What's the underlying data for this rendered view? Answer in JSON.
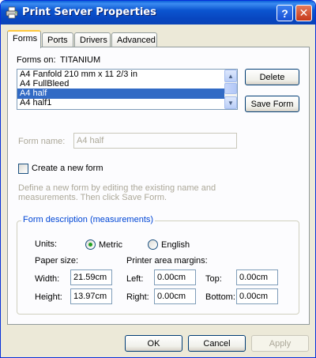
{
  "window": {
    "title": "Print Server Properties",
    "help_button": "?",
    "close_button": "✕"
  },
  "tabs": [
    {
      "label": "Forms"
    },
    {
      "label": "Ports"
    },
    {
      "label": "Drivers"
    },
    {
      "label": "Advanced"
    }
  ],
  "forms": {
    "forms_on_label": "Forms on:",
    "server_name": "TITANIUM",
    "list": [
      {
        "label": "A4 Fanfold 210 mm x 11 2/3 in"
      },
      {
        "label": "A4 FullBleed"
      },
      {
        "label": "A4 half"
      },
      {
        "label": "A4 half1"
      }
    ],
    "selected_index": 2,
    "delete_button": "Delete",
    "save_button": "Save Form",
    "form_name_label": "Form name:",
    "form_name_value": "A4 half",
    "create_new_label": "Create a new form",
    "create_new_checked": false,
    "instructions": "Define a new form by editing the existing name and measurements.  Then click Save Form."
  },
  "description": {
    "group_title": "Form description (measurements)",
    "units_label": "Units:",
    "metric_label": "Metric",
    "english_label": "English",
    "selected_unit": "Metric",
    "paper_size_label": "Paper size:",
    "margins_label": "Printer area margins:",
    "width_label": "Width:",
    "width_value": "21.59cm",
    "height_label": "Height:",
    "height_value": "13.97cm",
    "left_label": "Left:",
    "left_value": "0.00cm",
    "right_label": "Right:",
    "right_value": "0.00cm",
    "top_label": "Top:",
    "top_value": "0.00cm",
    "bottom_label": "Bottom:",
    "bottom_value": "0.00cm"
  },
  "footer": {
    "ok": "OK",
    "cancel": "Cancel",
    "apply": "Apply"
  },
  "colors": {
    "titlebar": "#0a55d0",
    "selection": "#316ac5",
    "dialog_bg": "#ece9d8",
    "group_title": "#0046d5"
  }
}
